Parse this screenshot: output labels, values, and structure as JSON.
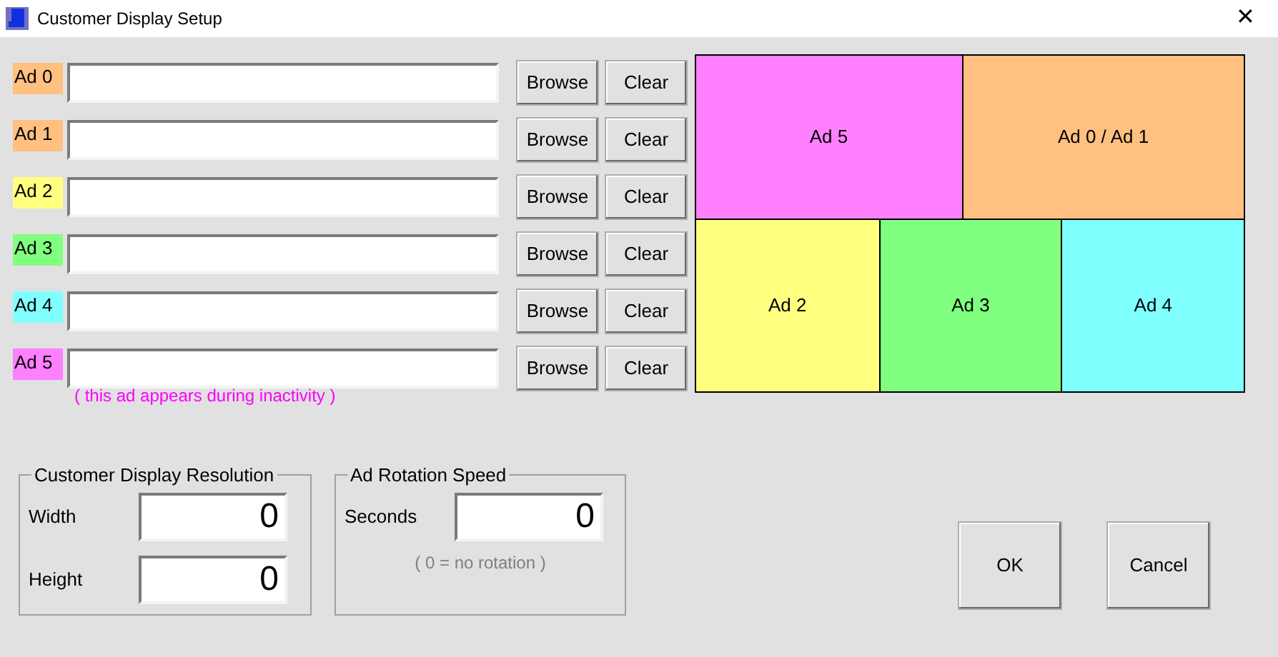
{
  "window": {
    "title": "Customer Display Setup",
    "close": "✕"
  },
  "ads": [
    {
      "label": "Ad 0",
      "color": "#ffc080",
      "buttons": [
        "Browse",
        "Clear"
      ]
    },
    {
      "label": "Ad 1",
      "color": "#ffc080",
      "buttons": [
        "Browse",
        "Clear"
      ]
    },
    {
      "label": "Ad 2",
      "color": "#ffff80",
      "buttons": [
        "Browse",
        "Clear"
      ]
    },
    {
      "label": "Ad 3",
      "color": "#80ff80",
      "buttons": [
        "Browse",
        "Clear"
      ]
    },
    {
      "label": "Ad 4",
      "color": "#80ffff",
      "buttons": [
        "Browse",
        "Clear"
      ]
    },
    {
      "label": "Ad 5",
      "color": "#ff80ff",
      "buttons": [
        "Browse",
        "Clear"
      ]
    }
  ],
  "inactivity_note": "( this ad appears during inactivity )",
  "layout_preview": {
    "rows": [
      [
        {
          "label": "Ad 5",
          "color": "#ff80ff"
        },
        {
          "label": "Ad 0 / Ad 1",
          "color": "#ffc080"
        }
      ],
      [
        {
          "label": "Ad 2",
          "color": "#ffff80"
        },
        {
          "label": "Ad 3",
          "color": "#80ff80"
        },
        {
          "label": "Ad 4",
          "color": "#80ffff"
        }
      ]
    ]
  },
  "resolution": {
    "title": "Customer Display Resolution",
    "fields": [
      {
        "label": "Width",
        "value": "0"
      },
      {
        "label": "Height",
        "value": "0"
      }
    ]
  },
  "rotation": {
    "title": "Ad Rotation Speed",
    "fields": [
      {
        "label": "Seconds",
        "value": "0"
      }
    ],
    "note": "( 0 = no rotation )"
  },
  "buttons": [
    "OK",
    "Cancel"
  ]
}
